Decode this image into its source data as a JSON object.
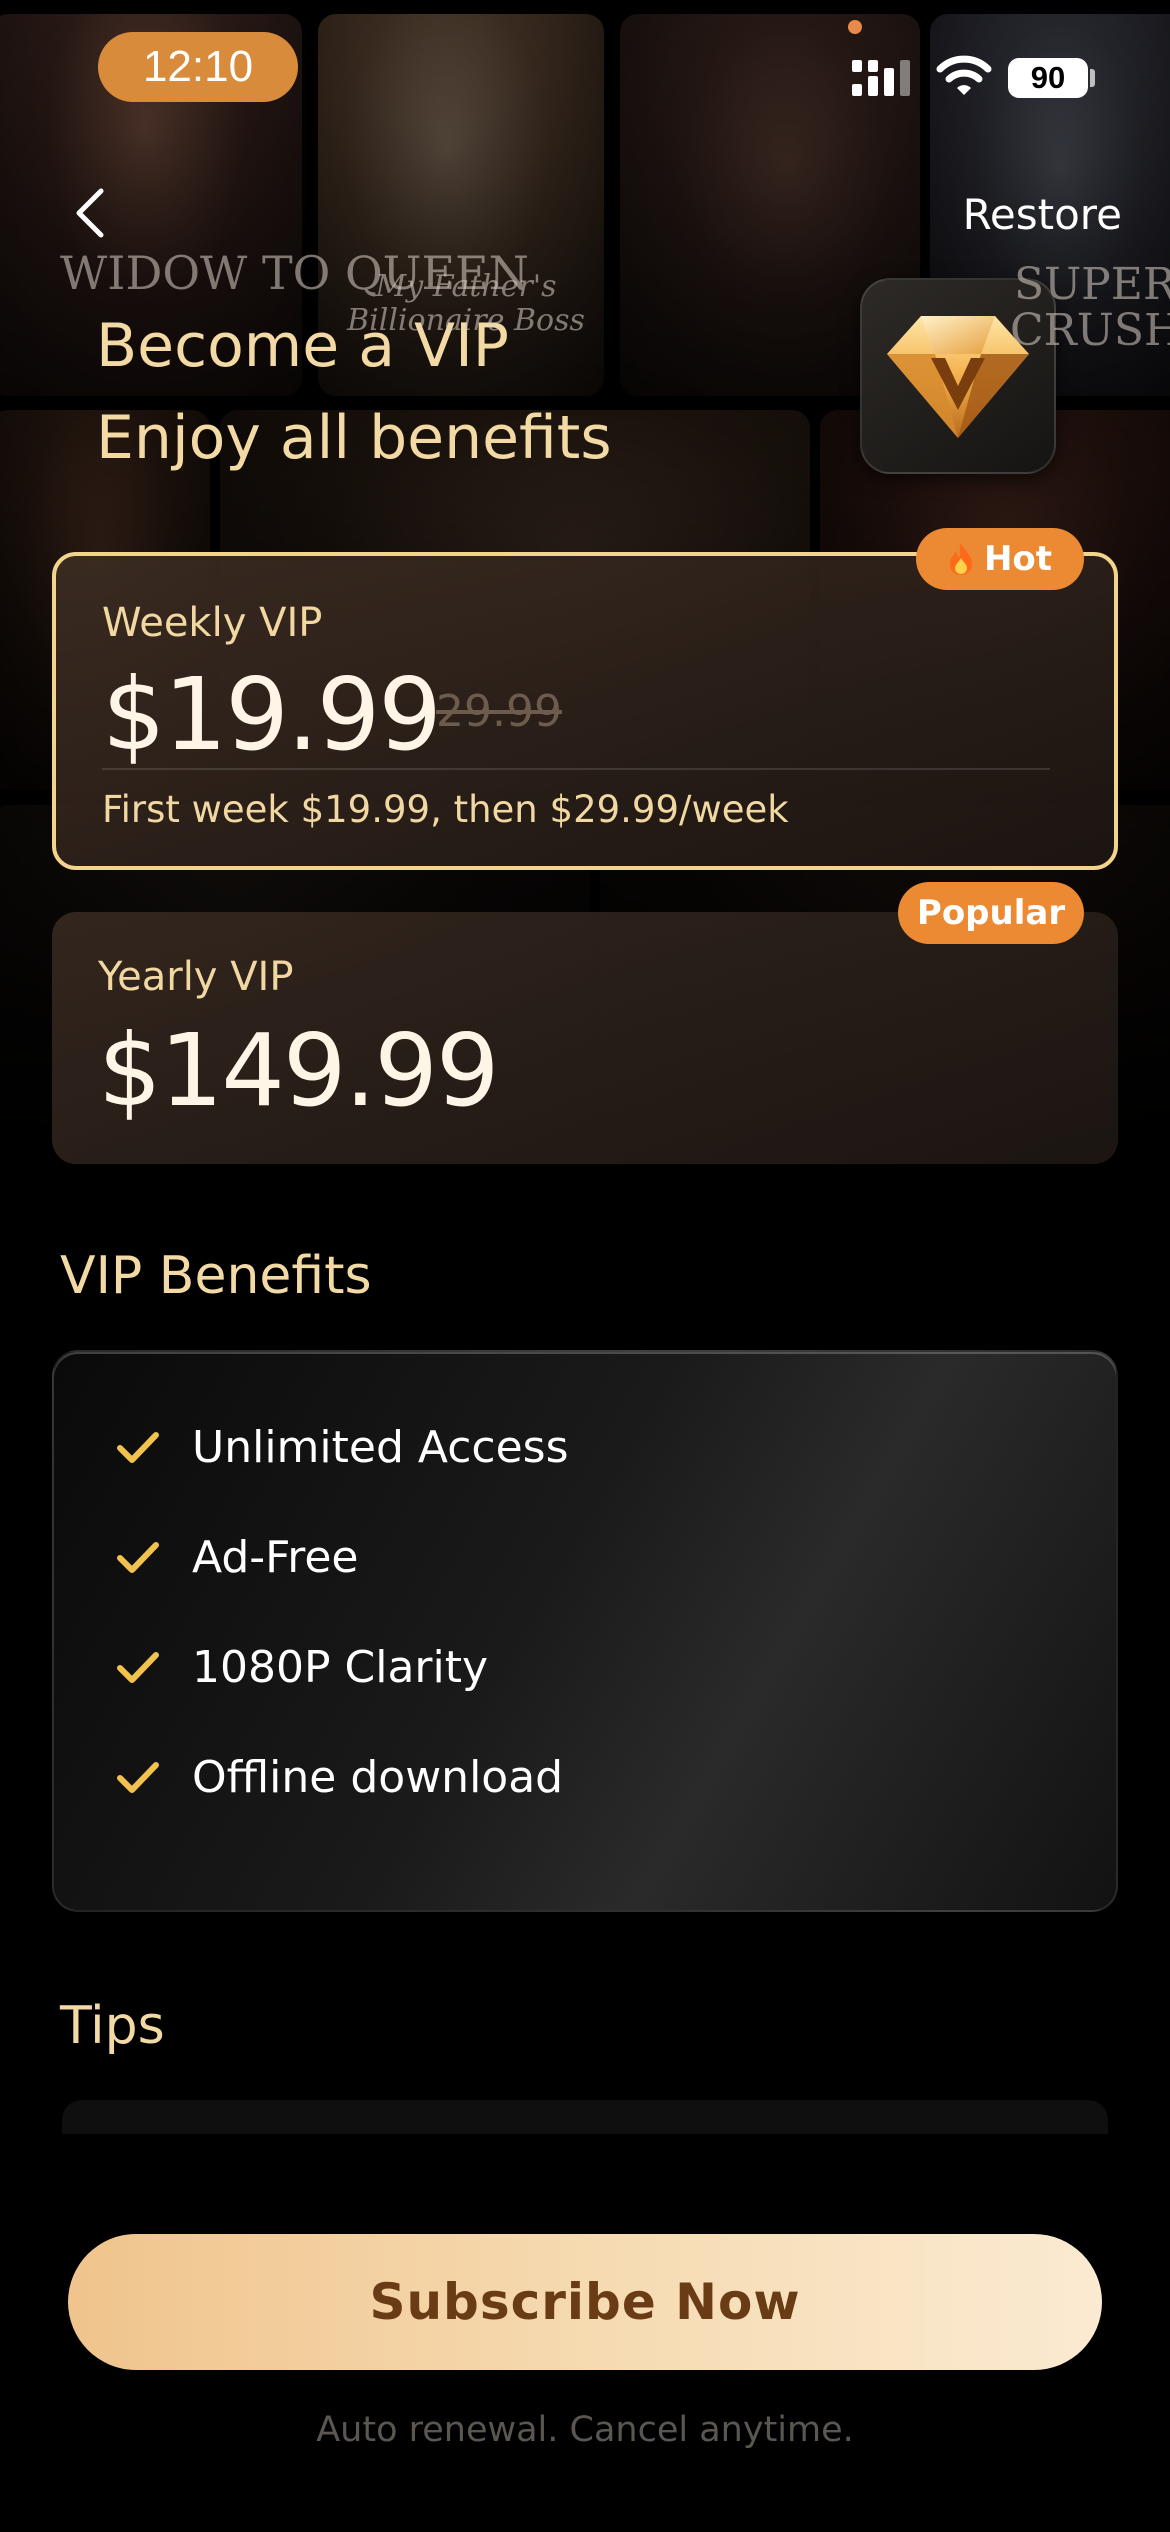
{
  "status_bar": {
    "time": "12:10",
    "battery": "90",
    "icons": [
      "signal-icon",
      "wifi-icon",
      "battery-icon"
    ]
  },
  "background": {
    "poster_titles": [
      "WIDOW TO QUEEN",
      "My Father's Billionaire Boss",
      "SUPER CRUSH"
    ]
  },
  "header": {
    "back_icon": "chevron-left-icon",
    "restore_label": "Restore",
    "title_line1": "Become a VIP",
    "title_line2": "Enjoy all benefits",
    "badge_icon": "diamond-v-icon"
  },
  "plans": [
    {
      "name": "Weekly VIP",
      "price": "$19.99",
      "original_price": "29.99",
      "note": "First week $19.99, then $29.99/week",
      "badge": "Hot",
      "badge_icon": "fire-icon",
      "selected": true
    },
    {
      "name": "Yearly VIP",
      "price": "$149.99",
      "badge": "Popular",
      "selected": false
    }
  ],
  "benefits": {
    "title": "VIP Benefits",
    "items": [
      {
        "label": "Unlimited Access",
        "icon": "check-icon"
      },
      {
        "label": "Ad-Free",
        "icon": "check-icon"
      },
      {
        "label": "1080P Clarity",
        "icon": "check-icon"
      },
      {
        "label": "Offline download",
        "icon": "check-icon"
      }
    ]
  },
  "tips": {
    "title": "Tips"
  },
  "cta": {
    "subscribe_label": "Subscribe Now",
    "auto_renewal_note": "Auto renewal. Cancel anytime."
  },
  "colors": {
    "gold_text": "#f3d9a4",
    "accent_orange": "#eb8a32",
    "selected_border": "#f2d48d",
    "button_gradient_start": "#f0c48c",
    "button_gradient_end": "#fbead2",
    "button_text": "#6a3c16"
  }
}
